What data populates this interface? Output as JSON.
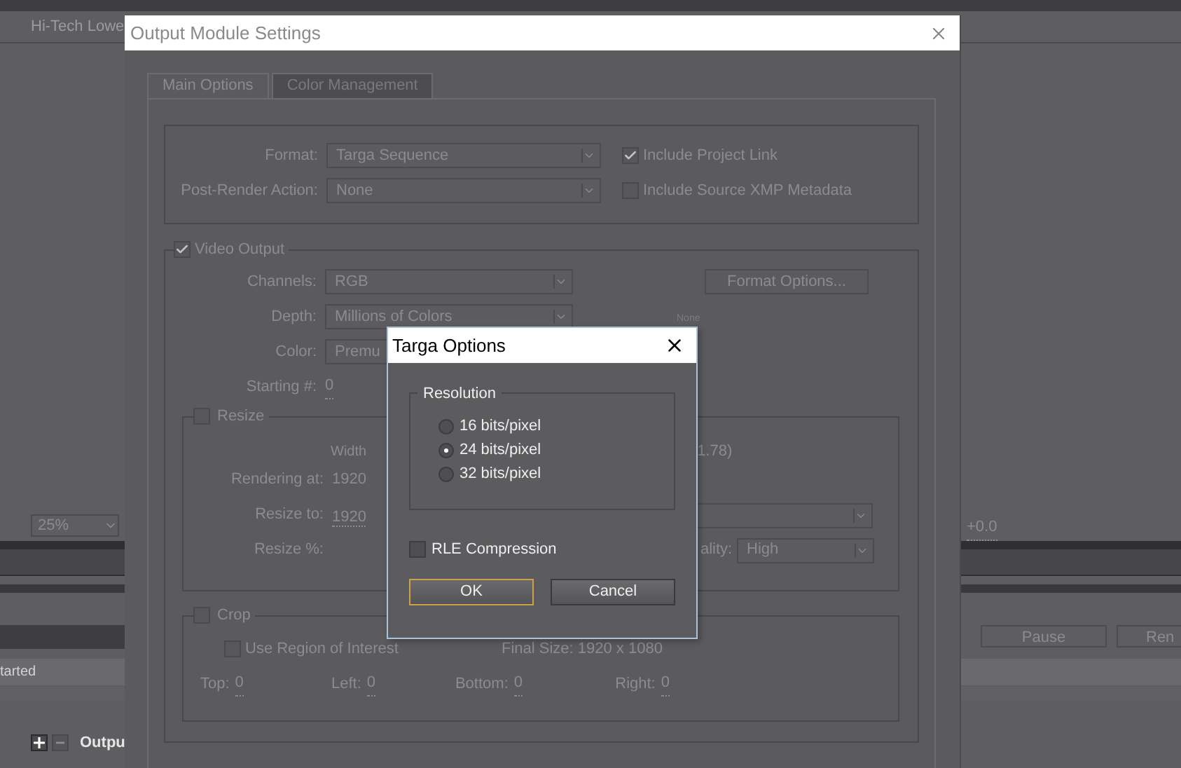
{
  "background": {
    "top_label": "Hi-Tech Lowe",
    "zoom": "25%",
    "offset": "+0.0",
    "buttons": [
      "Pause",
      "Ren"
    ],
    "status": "tarted",
    "panel_label": "Outpu"
  },
  "output_module": {
    "title": "Output Module Settings",
    "tabs": [
      {
        "label": "Main Options",
        "selected": true
      },
      {
        "label": "Color Management",
        "selected": false
      }
    ],
    "general": [
      {
        "label": "Format:",
        "value": "Targa Sequence",
        "option": "Include Project Link",
        "checked": true
      },
      {
        "label": "Post-Render Action:",
        "value": "None",
        "option": "Include Source XMP Metadata",
        "checked": false
      }
    ],
    "video_output": {
      "label": "Video Output",
      "checked": true,
      "rows": [
        {
          "label": "Channels:",
          "value": "RGB"
        },
        {
          "label": "Depth:",
          "value": "Millions of Colors"
        },
        {
          "label": "Color:",
          "value": "Premu"
        }
      ],
      "starting": {
        "label": "Starting #:",
        "value": "0"
      },
      "format_options": "Format Options...",
      "note": "None"
    },
    "resize": {
      "label": "Resize",
      "checked": false,
      "width_heading": "Width",
      "ratio": "1.78)",
      "rendering_label": "Rendering at:",
      "rendering_value": "1920",
      "resize_to_label": "Resize to:",
      "resize_to_value": "1920",
      "percent_label": "Resize %:",
      "quality_label": "ality:",
      "quality_value": "High"
    },
    "crop": {
      "label": "Crop",
      "checked": false,
      "roi": {
        "label": "Use Region of Interest",
        "checked": false
      },
      "final_size": "Final Size: 1920 x 1080",
      "sides": [
        {
          "label": "Top:",
          "value": "0"
        },
        {
          "label": "Left:",
          "value": "0"
        },
        {
          "label": "Bottom:",
          "value": "0"
        },
        {
          "label": "Right:",
          "value": "0"
        }
      ]
    }
  },
  "targa": {
    "title": "Targa Options",
    "group": "Resolution",
    "options": [
      {
        "label": "16 bits/pixel",
        "selected": false
      },
      {
        "label": "24 bits/pixel",
        "selected": true
      },
      {
        "label": "32 bits/pixel",
        "selected": false
      }
    ],
    "rle": {
      "label": "RLE Compression",
      "checked": false
    },
    "buttons": [
      {
        "label": "OK",
        "kind": "default"
      },
      {
        "label": "Cancel",
        "kind": "normal"
      }
    ]
  }
}
